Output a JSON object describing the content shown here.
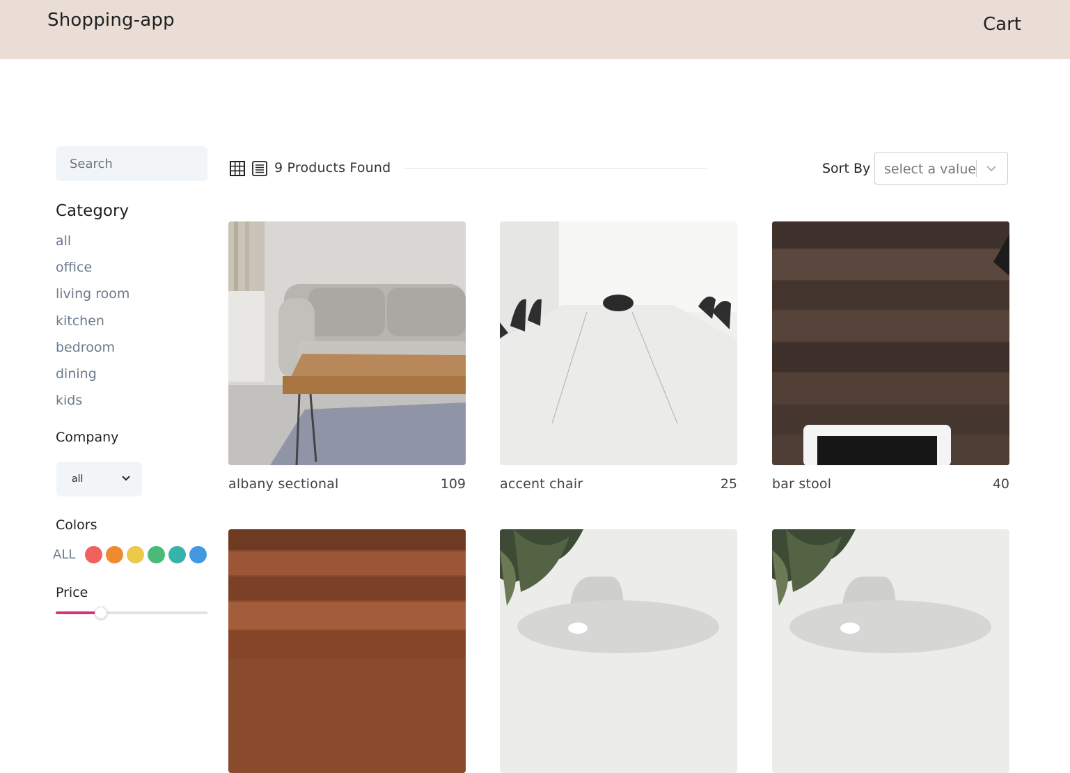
{
  "header": {
    "brand": "Shopping-app",
    "cart_label": "Cart"
  },
  "sidebar": {
    "search": {
      "placeholder": "Search",
      "value": ""
    },
    "category": {
      "title": "Category",
      "items": [
        "all",
        "office",
        "living room",
        "kitchen",
        "bedroom",
        "dining",
        "kids"
      ]
    },
    "company": {
      "title": "Company",
      "selected": "all"
    },
    "colors": {
      "title": "Colors",
      "all_label": "ALL",
      "swatches": [
        "#f0625d",
        "#ef8a33",
        "#ecc94b",
        "#48bb78",
        "#38b2ac",
        "#4299e1"
      ]
    },
    "price": {
      "title": "Price",
      "fraction": 0.3
    }
  },
  "toolbar": {
    "count_text": "9 Products Found",
    "sort_label": "Sort By",
    "sort_placeholder": "select a value"
  },
  "products": [
    {
      "name": "albany sectional",
      "price": "109"
    },
    {
      "name": "accent chair",
      "price": "25"
    },
    {
      "name": "bar stool",
      "price": "40"
    },
    {
      "name": "",
      "price": ""
    },
    {
      "name": "",
      "price": ""
    },
    {
      "name": "",
      "price": ""
    }
  ],
  "colors": {
    "header_bg": "#e9ddd6",
    "price_accent": "#d6337e"
  }
}
